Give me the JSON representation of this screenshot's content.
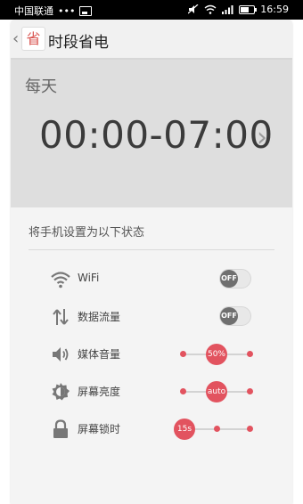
{
  "status_bar": {
    "carrier": "中国联通",
    "dots": "•••",
    "time": "16:59",
    "icons": [
      "image-icon",
      "mute-icon",
      "wifi-icon",
      "signal-icon",
      "battery-icon"
    ]
  },
  "header": {
    "title": "时段省电",
    "app_icon_glyph": "省"
  },
  "schedule": {
    "period": "每天",
    "time_range": "00:00-07:00"
  },
  "settings": {
    "section_title": "将手机设置为以下状态",
    "rows": [
      {
        "label": "WiFi",
        "icon": "wifi-icon",
        "control": "toggle",
        "value": "OFF"
      },
      {
        "label": "数据流量",
        "icon": "data-arrows-icon",
        "control": "toggle",
        "value": "OFF"
      },
      {
        "label": "媒体音量",
        "icon": "speaker-icon",
        "control": "slider",
        "value": "50%",
        "position": 1
      },
      {
        "label": "屏幕亮度",
        "icon": "brightness-icon",
        "control": "slider",
        "value": "auto",
        "position": 1
      },
      {
        "label": "屏幕锁时",
        "icon": "lock-icon",
        "control": "slider",
        "value": "15s",
        "position": 0
      }
    ]
  },
  "colors": {
    "accent": "#e2535f",
    "toggle_knob": "#6f6f6f"
  }
}
